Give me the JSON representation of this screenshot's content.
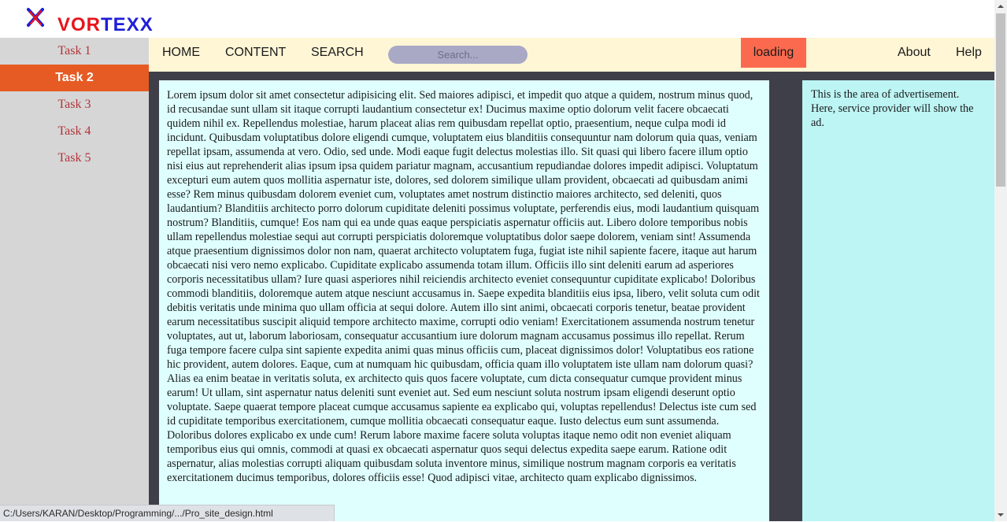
{
  "brand": {
    "part1": "VOR",
    "part2": "TEXX",
    "logo_icon": "x-logo-icon",
    "colors": {
      "red": "#e8141c",
      "blue": "#1d1ed8"
    }
  },
  "sidebar": {
    "items": [
      {
        "label": "Task 1",
        "active": false
      },
      {
        "label": "Task 2",
        "active": true
      },
      {
        "label": "Task 3",
        "active": false
      },
      {
        "label": "Task 4",
        "active": false
      },
      {
        "label": "Task 5",
        "active": false
      }
    ],
    "active_color": "#e65b24"
  },
  "nav": {
    "home": "HOME",
    "content": "CONTENT",
    "search": "SEARCH",
    "search_placeholder": "Search...",
    "loading": "loading",
    "about": "About",
    "help": "Help",
    "loading_color": "#fb6a4e"
  },
  "article": {
    "text": "Lorem ipsum dolor sit amet consectetur adipisicing elit. Sed maiores adipisci, et impedit quo atque a quidem, nostrum minus quod, id recusandae sunt ullam sit itaque corrupti laudantium consectetur ex! Ducimus maxime optio dolorum velit facere obcaecati quidem nihil ex. Repellendus molestiae, harum placeat alias rem quibusdam repellat optio, praesentium, neque culpa modi id incidunt. Quibusdam voluptatibus dolore eligendi cumque, voluptatem eius blanditiis consequuntur nam dolorum quia quas, veniam repellat ipsam, assumenda at vero. Odio, sed unde. Modi eaque fugit delectus molestias illo. Sit quasi qui libero facere illum optio nisi eius aut reprehenderit alias ipsum ipsa quidem pariatur magnam, accusantium repudiandae dolores impedit adipisci. Voluptatum excepturi eum autem quos mollitia aspernatur iste, dolores, sed dolorem similique ullam provident, obcaecati ad quibusdam animi esse? Rem minus quibusdam dolorem eveniet cum, voluptates amet nostrum distinctio maiores architecto, sed deleniti, quos laudantium? Blanditiis architecto porro dolorum cupiditate deleniti possimus voluptate, perferendis eius, modi laudantium quisquam nostrum? Blanditiis, cumque! Eos nam qui ea unde quas eaque perspiciatis aspernatur officiis aut. Libero dolore temporibus nobis ullam repellendus molestiae sequi aut corrupti perspiciatis doloremque voluptatibus dolor saepe dolorem, veniam sint! Assumenda atque praesentium dignissimos dolor non nam, quaerat architecto voluptatem fuga, fugiat iste nihil sapiente facere, itaque aut harum obcaecati nisi vero nemo explicabo. Cupiditate explicabo assumenda totam illum. Officiis illo sint deleniti earum ad asperiores corporis necessitatibus ullam? Iure quasi asperiores nihil reiciendis architecto eveniet consequuntur cupiditate explicabo! Doloribus commodi blanditiis, doloremque autem atque nesciunt accusamus in. Saepe expedita blanditiis eius ipsa, libero, velit soluta cum odit debitis veritatis unde minima quo ullam officia at sequi dolore. Autem illo sint animi, obcaecati corporis tenetur, beatae provident earum necessitatibus suscipit aliquid tempore architecto maxime, corrupti odio veniam! Exercitationem assumenda nostrum tenetur voluptates, aut ut, laborum laboriosam, consequatur accusantium iure dolorum magnam accusamus possimus illo repellat. Rerum fuga tempore facere culpa sint sapiente expedita animi quas minus officiis cum, placeat dignissimos dolor! Voluptatibus eos ratione hic provident, autem dolores. Eaque, cum at numquam hic quibusdam, officia quam illo voluptatem iste ullam nam dolorum quasi? Alias ea enim beatae in veritatis soluta, ex architecto quis quos facere voluptate, cum dicta consequatur cumque provident minus earum! Ut ullam, sint aspernatur natus deleniti sunt eveniet aut. Sed eum nesciunt soluta nostrum ipsam eligendi deserunt optio voluptate. Saepe quaerat tempore placeat cumque accusamus sapiente ea explicabo qui, voluptas repellendus! Delectus iste cum sed id cupiditate temporibus exercitationem, cumque mollitia obcaecati consequatur eaque. Iusto delectus eum sunt assumenda. Doloribus dolores explicabo ex unde cum! Rerum labore maxime facere soluta voluptas itaque nemo odit non eveniet aliquam temporibus eius qui omnis, commodi at quasi ex obcaecati aspernatur quos sequi delectus expedita saepe earum. Ratione odit aspernatur, alias molestias corrupti aliquam quibusdam soluta inventore minus, similique nostrum magnam corporis ea veritatis exercitationem ducimus temporibus, dolores officiis esse! Quod adipisci vitae, architecto quam explicabo dignissimos."
  },
  "ad": {
    "text": "This is the area of advertisement. Here, service provider will show the ad."
  },
  "status_bar": {
    "url": "C:/Users/KARAN/Desktop/Programming/.../Pro_site_design.html"
  },
  "colors": {
    "nav_bg": "#fff6d6",
    "sidebar_bg": "#d6d6d6",
    "frame_bg": "#3f3f4a",
    "article_bg": "#dfffff",
    "ad_bg": "#bdf4f4"
  }
}
